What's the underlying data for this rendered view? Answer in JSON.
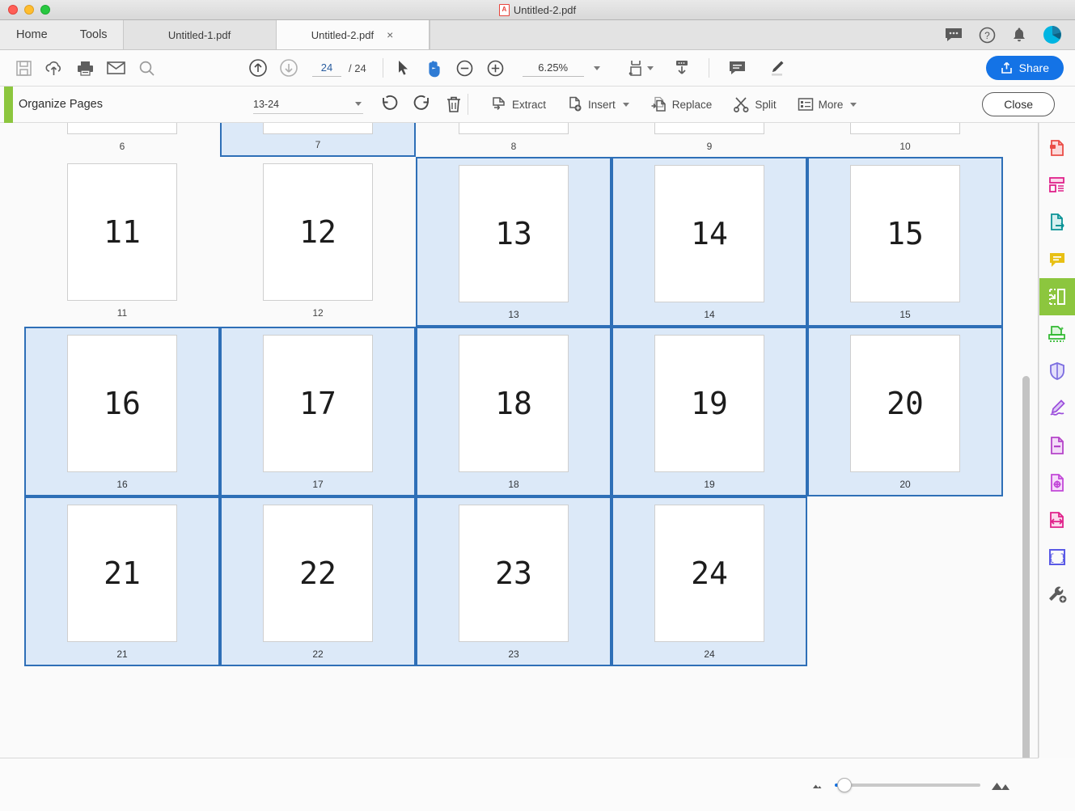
{
  "window": {
    "title": "Untitled-2.pdf",
    "file_icon": "pdf-file-icon"
  },
  "tabbar": {
    "home_label": "Home",
    "tools_label": "Tools",
    "tabs": [
      {
        "label": "Untitled-1.pdf",
        "active": false,
        "closable": false
      },
      {
        "label": "Untitled-2.pdf",
        "active": true,
        "closable": true,
        "close_glyph": "×"
      }
    ],
    "right_icons": [
      "comment-bubble-icon",
      "help-circle-icon",
      "bell-icon",
      "avatar"
    ]
  },
  "toolbar": {
    "icons_left": [
      "save-icon",
      "upload-cloud-icon",
      "print-icon",
      "email-icon",
      "search-icon"
    ],
    "page_up_icon": "page-up-icon",
    "page_down_icon": "page-down-icon",
    "current_page": "24",
    "page_total": "/ 24",
    "select_tool_icon": "cursor-select-icon",
    "hand_tool_icon": "hand-tool-icon",
    "zoom_out_icon": "zoom-out-icon",
    "zoom_in_icon": "zoom-in-icon",
    "zoom_level": "6.25%",
    "fit_page_icon": "fit-page-icon",
    "scroll_mode_icon": "page-scroll-icon",
    "comment_icon": "comment-icon",
    "highlight_icon": "highlight-pen-icon",
    "share_label": "Share",
    "share_icon": "share-upload-icon",
    "accent_color": "#1473e6"
  },
  "organize": {
    "title": "Organize Pages",
    "range_value": "13-24",
    "rotate_ccw_icon": "rotate-counterclockwise-icon",
    "rotate_cw_icon": "rotate-clockwise-icon",
    "delete_icon": "trash-icon",
    "actions": [
      {
        "label": "Extract",
        "icon": "extract-icon",
        "has_caret": false
      },
      {
        "label": "Insert",
        "icon": "insert-icon",
        "has_caret": true
      },
      {
        "label": "Replace",
        "icon": "replace-icon",
        "has_caret": false
      },
      {
        "label": "Split",
        "icon": "split-scissors-icon",
        "has_caret": false
      },
      {
        "label": "More",
        "icon": "more-list-icon",
        "has_caret": true
      }
    ],
    "close_label": "Close",
    "accent_color": "#8cc63e"
  },
  "pages": {
    "partial_top_row": [
      {
        "number": "6",
        "caption": "6",
        "selected": false
      },
      {
        "number": "7",
        "caption": "7",
        "selected": true
      },
      {
        "number": "8",
        "caption": "8",
        "selected": false
      },
      {
        "number": "9",
        "caption": "9",
        "selected": false
      },
      {
        "number": "10",
        "caption": "10",
        "selected": false
      }
    ],
    "rows": [
      [
        {
          "number": "11",
          "caption": "11",
          "selected": false
        },
        {
          "number": "12",
          "caption": "12",
          "selected": false
        },
        {
          "number": "13",
          "caption": "13",
          "selected": true
        },
        {
          "number": "14",
          "caption": "14",
          "selected": true
        },
        {
          "number": "15",
          "caption": "15",
          "selected": true
        }
      ],
      [
        {
          "number": "16",
          "caption": "16",
          "selected": true
        },
        {
          "number": "17",
          "caption": "17",
          "selected": true
        },
        {
          "number": "18",
          "caption": "18",
          "selected": true
        },
        {
          "number": "19",
          "caption": "19",
          "selected": true
        },
        {
          "number": "20",
          "caption": "20",
          "selected": true
        }
      ],
      [
        {
          "number": "21",
          "caption": "21",
          "selected": true
        },
        {
          "number": "22",
          "caption": "22",
          "selected": true
        },
        {
          "number": "23",
          "caption": "23",
          "selected": true
        },
        {
          "number": "24",
          "caption": "24",
          "selected": true
        }
      ]
    ],
    "selection_border_color": "#2e6fb7",
    "selection_fill_color": "#dce9f8"
  },
  "right_sidebar": {
    "items": [
      {
        "icon": "create-pdf-icon",
        "color": "#ea4c46",
        "active": false
      },
      {
        "icon": "edit-pdf-icon",
        "color": "#e0218a",
        "active": false
      },
      {
        "icon": "export-pdf-icon",
        "color": "#0a9396",
        "active": false
      },
      {
        "icon": "comment-tool-icon",
        "color": "#e8c014",
        "active": false
      },
      {
        "icon": "organize-pages-icon",
        "color": "#ffffff",
        "active": true
      },
      {
        "icon": "enhance-scans-icon",
        "color": "#2eb82e",
        "active": false
      },
      {
        "icon": "protect-shield-icon",
        "color": "#7b6ce0",
        "active": false
      },
      {
        "icon": "fill-and-sign-icon",
        "color": "#9b4ddb",
        "active": false
      },
      {
        "icon": "send-for-signature-icon",
        "color": "#b544c9",
        "active": false
      },
      {
        "icon": "redact-icon",
        "color": "#c248d8",
        "active": false
      },
      {
        "icon": "optimize-pdf-icon",
        "color": "#e0218a",
        "active": false
      },
      {
        "icon": "prepare-form-icon",
        "color": "#5a5ae6",
        "active": false
      },
      {
        "icon": "more-tools-wrench-icon",
        "color": "#5c5c5c",
        "active": false
      }
    ],
    "active_background": "#8cc63e"
  },
  "bottom": {
    "small_thumb_icon": "small-thumbnail-icon",
    "large_thumb_icon": "large-thumbnail-icon",
    "slider_name": "thumbnail-size-slider",
    "slider_position_percent": "3"
  }
}
